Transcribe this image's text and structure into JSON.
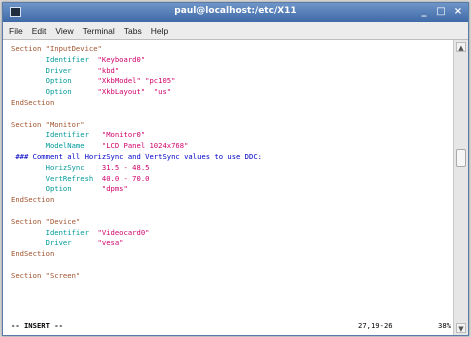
{
  "window": {
    "title": "paul@localhost:/etc/X11"
  },
  "menu": [
    "File",
    "Edit",
    "View",
    "Terminal",
    "Tabs",
    "Help"
  ],
  "colors": {
    "section": "#a0522d",
    "key": "#009a9a",
    "string": "#d0006a",
    "comment": "#0000c8"
  },
  "lines": [
    {
      "segs": [
        {
          "c": "kw",
          "t": "Section \"InputDevice\""
        }
      ]
    },
    {
      "segs": [
        {
          "c": "key",
          "t": "        Identifier"
        },
        {
          "c": "str",
          "t": "  \"Keyboard0\""
        }
      ]
    },
    {
      "segs": [
        {
          "c": "key",
          "t": "        Driver    "
        },
        {
          "c": "str",
          "t": "  \"kbd\""
        }
      ]
    },
    {
      "segs": [
        {
          "c": "key",
          "t": "        Option    "
        },
        {
          "c": "str",
          "t": "  \"XkbModel\" \"pc105\""
        }
      ]
    },
    {
      "segs": [
        {
          "c": "key",
          "t": "        Option    "
        },
        {
          "c": "str",
          "t": "  \"XkbLayout\"  \"us\""
        }
      ]
    },
    {
      "segs": [
        {
          "c": "kw",
          "t": "EndSection"
        }
      ]
    },
    {
      "segs": [
        {
          "c": "",
          "t": ""
        }
      ]
    },
    {
      "segs": [
        {
          "c": "kw",
          "t": "Section \"Monitor\""
        }
      ]
    },
    {
      "segs": [
        {
          "c": "key",
          "t": "        Identifier"
        },
        {
          "c": "str",
          "t": "   \"Monitor0\""
        }
      ]
    },
    {
      "segs": [
        {
          "c": "key",
          "t": "        ModelName "
        },
        {
          "c": "str",
          "t": "   \"LCD Panel 1024x768\""
        }
      ]
    },
    {
      "segs": [
        {
          "c": "comment",
          "t": " ### Comment all HorizSync and VertSync values to use DDC:"
        }
      ]
    },
    {
      "segs": [
        {
          "c": "key",
          "t": "        HorizSync "
        },
        {
          "c": "str",
          "t": "   31.5 - 48.5"
        }
      ]
    },
    {
      "segs": [
        {
          "c": "key",
          "t": "        VertRefresh"
        },
        {
          "c": "str",
          "t": "  40.0 - 70.0"
        }
      ]
    },
    {
      "segs": [
        {
          "c": "key",
          "t": "        Option    "
        },
        {
          "c": "str",
          "t": "   \"dpms\""
        }
      ]
    },
    {
      "segs": [
        {
          "c": "kw",
          "t": "EndSection"
        }
      ]
    },
    {
      "segs": [
        {
          "c": "",
          "t": ""
        }
      ]
    },
    {
      "segs": [
        {
          "c": "kw",
          "t": "Section \"Device\""
        }
      ]
    },
    {
      "segs": [
        {
          "c": "key",
          "t": "        Identifier"
        },
        {
          "c": "str",
          "t": "  \"Videocard0\""
        }
      ]
    },
    {
      "segs": [
        {
          "c": "key",
          "t": "        Driver    "
        },
        {
          "c": "str",
          "t": "  \"vesa\""
        }
      ]
    },
    {
      "segs": [
        {
          "c": "kw",
          "t": "EndSection"
        }
      ]
    },
    {
      "segs": [
        {
          "c": "",
          "t": ""
        }
      ]
    },
    {
      "segs": [
        {
          "c": "kw",
          "t": "Section \"Screen\""
        }
      ]
    }
  ],
  "status": {
    "mode": "-- INSERT --",
    "position": "27,19-26",
    "percent": "38%"
  },
  "scrollbar": {
    "position_fraction": 0.38
  }
}
